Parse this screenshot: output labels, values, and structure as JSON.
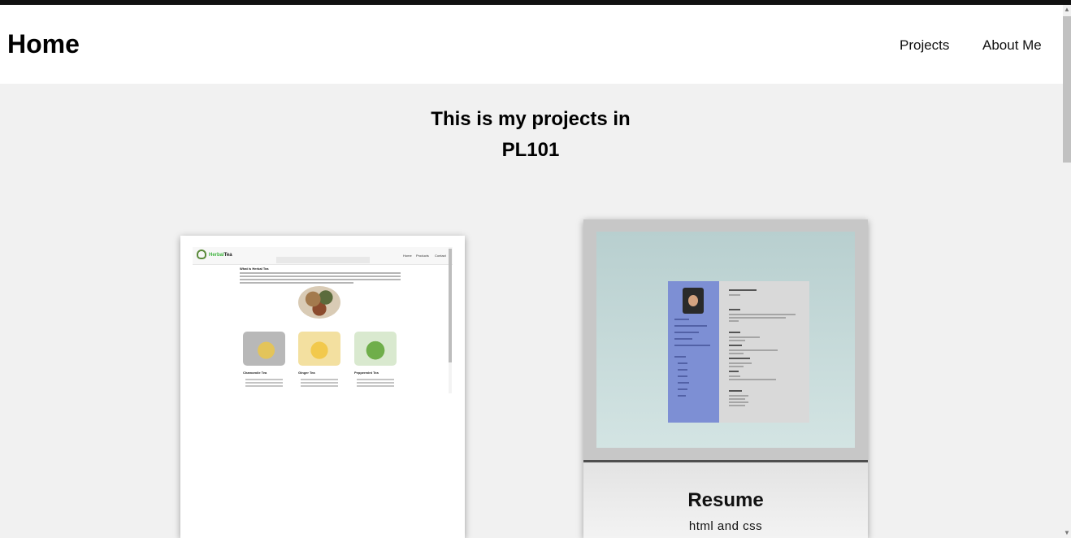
{
  "header": {
    "title": "Home",
    "nav": [
      {
        "label": "Projects"
      },
      {
        "label": "About Me"
      }
    ]
  },
  "hero": {
    "line1": "This is my projects in",
    "line2": "PL101"
  },
  "projects": [
    {
      "name": "Herbal Tea",
      "thumbnail": {
        "logo_prefix": "Herbal",
        "logo_suffix": "Tea",
        "nav": [
          "Home",
          "Products",
          "Contact"
        ],
        "heading": "What is Herbal Tea",
        "items": [
          "Chamomile Tea",
          "Ginger Tea",
          "Peppermint Tea"
        ]
      }
    },
    {
      "name": "Resume",
      "tech": "html and css"
    }
  ]
}
